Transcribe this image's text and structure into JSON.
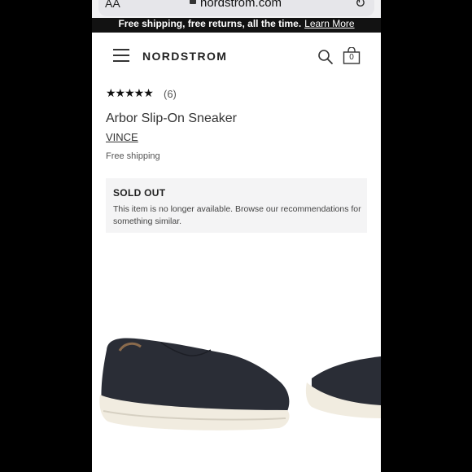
{
  "browser": {
    "aa_label": "AA",
    "url": "nordstrom.com"
  },
  "promo": {
    "text": "Free shipping, free returns, all the time.",
    "link": "Learn More"
  },
  "header": {
    "logo": "NORDSTROM",
    "bag_count": "0"
  },
  "product": {
    "stars": "★★★★★",
    "rating_count": "(6)",
    "title": "Arbor Slip-On Sneaker",
    "brand": "VINCE",
    "shipping": "Free shipping",
    "sold_out_title": "SOLD OUT",
    "sold_out_message": "This item is no longer available. Browse our recommendations for something similar."
  },
  "colors": {
    "promo_bg": "#121212",
    "notice_bg": "#f4f4f5",
    "shoe": "#2a2d36",
    "sole": "#f1ece0"
  }
}
